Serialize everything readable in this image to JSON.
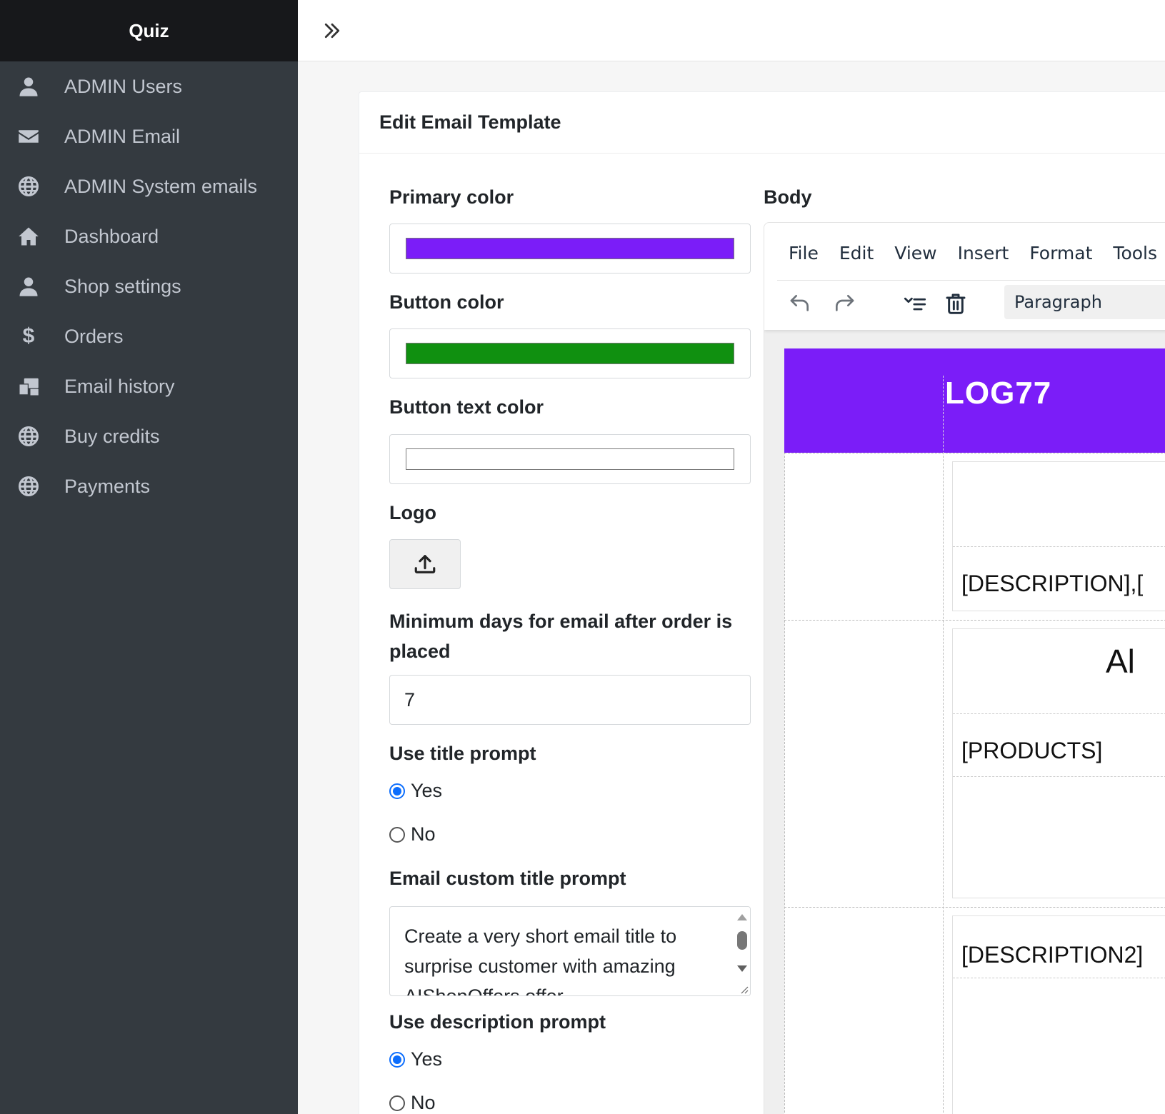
{
  "app": {
    "brand": "Quiz"
  },
  "sidebar": {
    "items": [
      {
        "label": "ADMIN Users",
        "icon": "user-icon"
      },
      {
        "label": "ADMIN Email",
        "icon": "envelope-icon"
      },
      {
        "label": "ADMIN System emails",
        "icon": "globe-icon"
      },
      {
        "label": "Dashboard",
        "icon": "home-icon"
      },
      {
        "label": "Shop settings",
        "icon": "user-icon"
      },
      {
        "label": "Orders",
        "icon": "dollar-icon"
      },
      {
        "label": "Email history",
        "icon": "mail-bulk-icon"
      },
      {
        "label": "Buy credits",
        "icon": "globe-icon"
      },
      {
        "label": "Payments",
        "icon": "globe-icon"
      }
    ]
  },
  "card": {
    "title": "Edit Email Template"
  },
  "form": {
    "primary_color_label": "Primary color",
    "primary_color": "#7b1df8",
    "button_color_label": "Button color",
    "button_color": "#109010",
    "button_text_color_label": "Button text color",
    "button_text_color": "#ffffff",
    "logo_label": "Logo",
    "min_days_label": "Minimum days for email after order is placed",
    "min_days_value": "7",
    "use_title_prompt_label": "Use title prompt",
    "title_yes": "Yes",
    "title_no": "No",
    "custom_title_label": "Email custom title prompt",
    "custom_title_text": "Create a very short email title to surprise customer with amazing AIShopOffers offer",
    "use_desc_prompt_label": "Use description prompt",
    "desc_yes": "Yes",
    "desc_no": "No"
  },
  "editor": {
    "body_label": "Body",
    "menu": [
      "File",
      "Edit",
      "View",
      "Insert",
      "Format",
      "Tools"
    ],
    "block_format": "Paragraph",
    "content": {
      "logo_text": "LOG77",
      "description": "[DESCRIPTION],[",
      "heading_partial": "Al",
      "products": "[PRODUCTS]",
      "description2": "[DESCRIPTION2]"
    }
  }
}
